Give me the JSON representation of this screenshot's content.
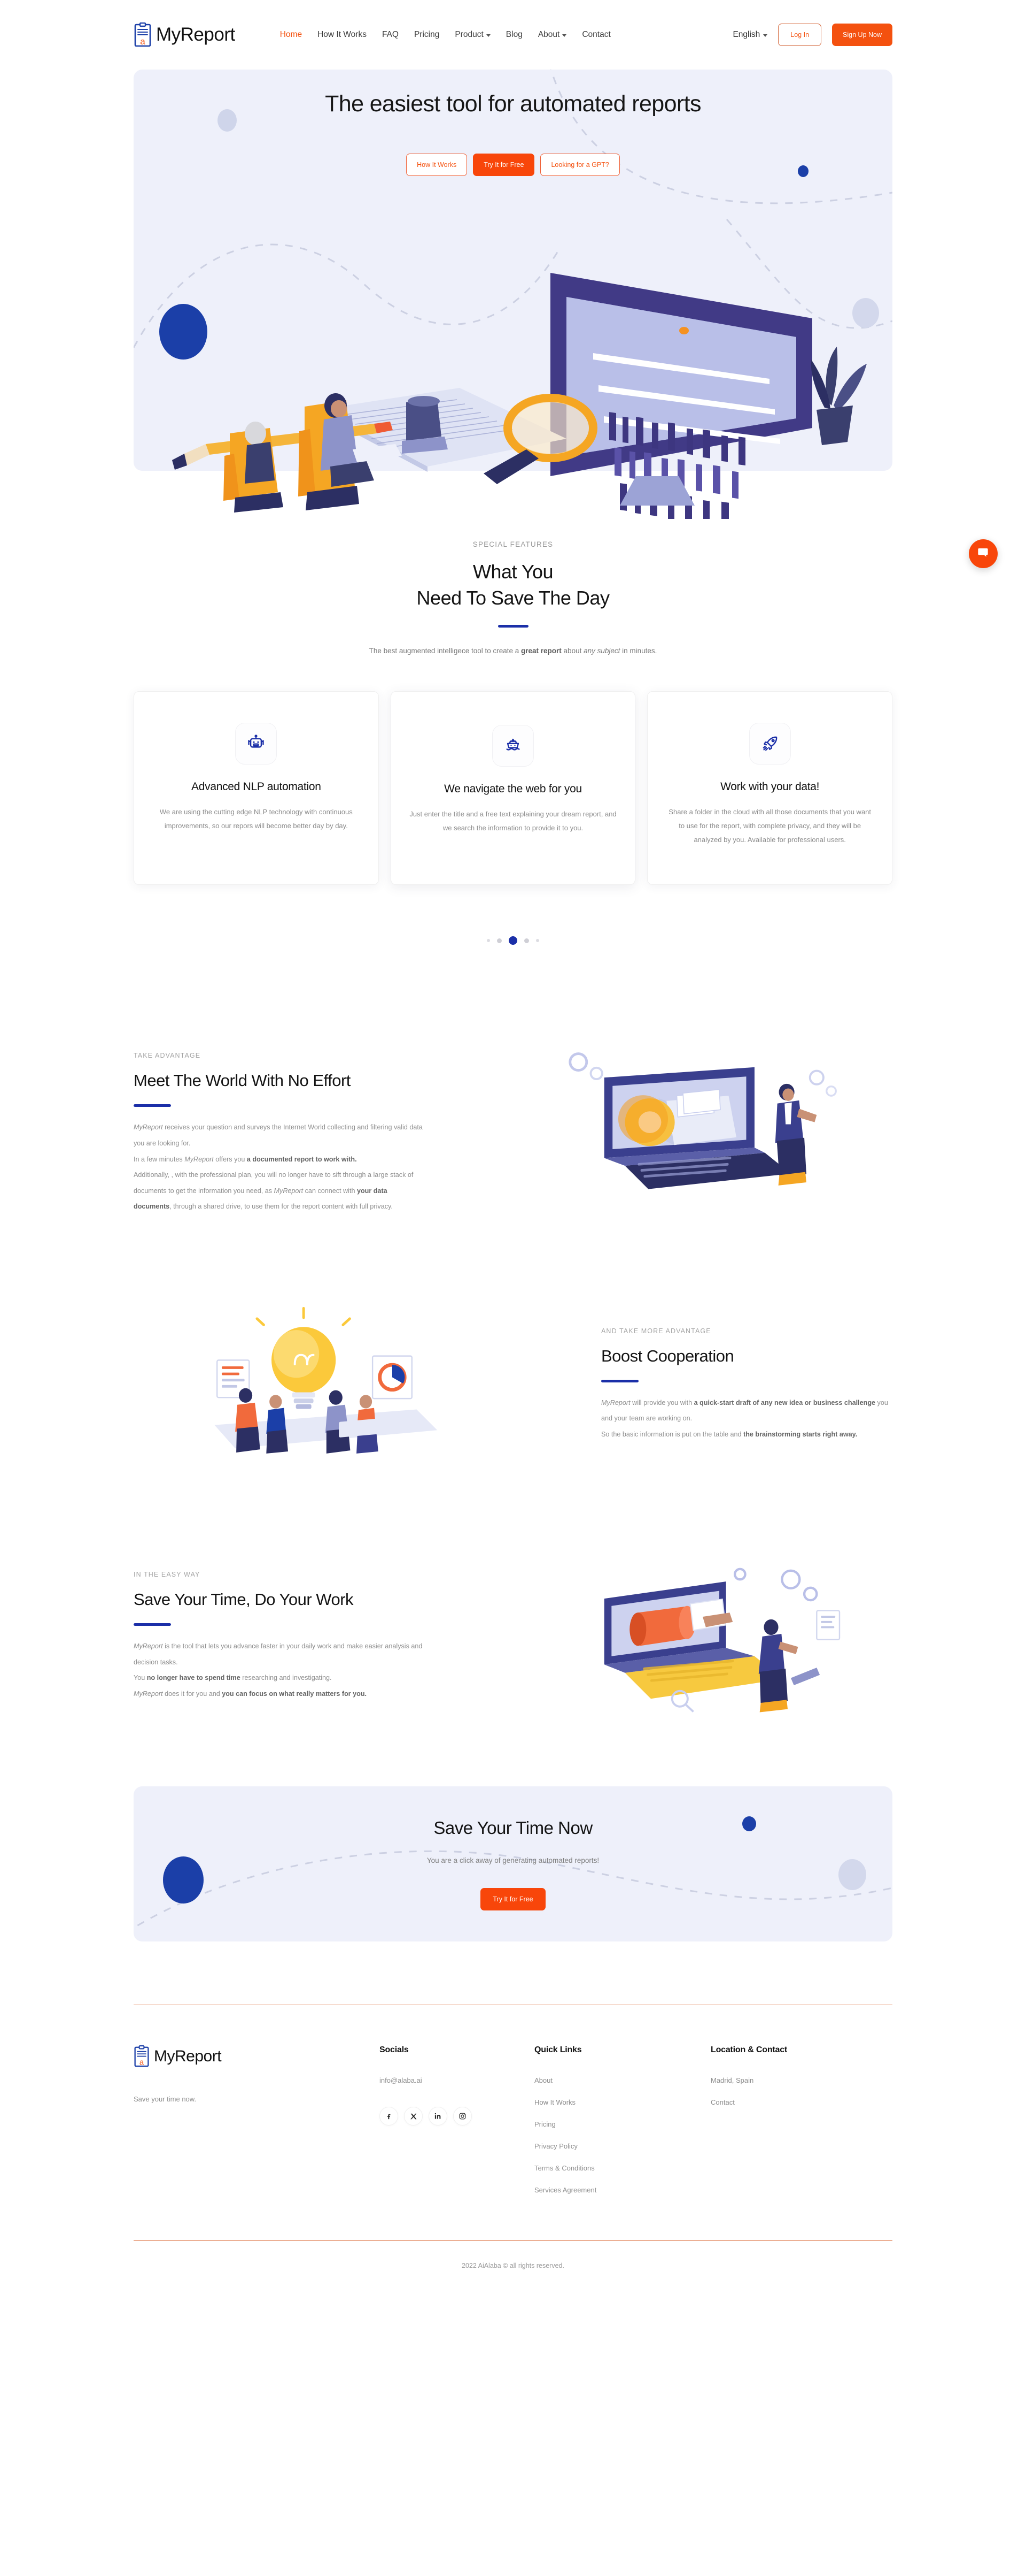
{
  "brand": {
    "name": "MyReport",
    "logo_icon": "clipboard-report-icon"
  },
  "nav": {
    "items": [
      {
        "label": "Home",
        "active": true,
        "caret": false
      },
      {
        "label": "How It Works",
        "active": false,
        "caret": false
      },
      {
        "label": "FAQ",
        "active": false,
        "caret": false
      },
      {
        "label": "Pricing",
        "active": false,
        "caret": false
      },
      {
        "label": "Product",
        "active": false,
        "caret": true
      },
      {
        "label": "Blog",
        "active": false,
        "caret": false
      },
      {
        "label": "About",
        "active": false,
        "caret": true
      },
      {
        "label": "Contact",
        "active": false,
        "caret": false
      }
    ],
    "language": "English",
    "login_label": "Log In",
    "signup_label": "Sign Up Now"
  },
  "hero": {
    "title": "The easiest tool for automated reports",
    "buttons": [
      {
        "label": "How It Works",
        "style": "outline"
      },
      {
        "label": "Try It for Free",
        "style": "primary"
      },
      {
        "label": "Looking for a GPT?",
        "style": "outline"
      }
    ]
  },
  "features": {
    "eyebrow": "SPECIAL FEATURES",
    "title_line1": "What You",
    "title_line2": "Need To Save The Day",
    "subtitle_pre": "The best augmented intelligece tool to create a ",
    "subtitle_bold": "great report",
    "subtitle_mid": " about ",
    "subtitle_italic": "any subject",
    "subtitle_post": " in minutes.",
    "cards": [
      {
        "icon": "robot-icon",
        "title": "Advanced NLP automation",
        "body": "We are using the cutting edge NLP technology with continuous improvements, so our repors will become better day by day."
      },
      {
        "icon": "ship-icon",
        "title": "We navigate the web for you",
        "body": "Just enter the title and a free text explaining your dream report, and we search the information to provide it to you."
      },
      {
        "icon": "rocket-icon",
        "title": "Work with your data!",
        "body": "Share a folder in the cloud with all those documents that you want to use for the report, with complete privacy, and they will be analyzed by you. Available for professional users."
      }
    ],
    "carousel": {
      "count": 5,
      "active_index": 2
    }
  },
  "sections": [
    {
      "eyebrow": "TAKE ADVANTAGE",
      "title": "Meet The World With No Effort",
      "paragraphs": [
        [
          {
            "t": "MyReport",
            "s": "i"
          },
          {
            "t": " receives your question and surveys the Internet World collecting and filtering valid data you are looking for.",
            "s": "n"
          }
        ],
        [
          {
            "t": "In a few minutes ",
            "s": "n"
          },
          {
            "t": "MyReport",
            "s": "i"
          },
          {
            "t": " offers you ",
            "s": "n"
          },
          {
            "t": "a documented report to work with.",
            "s": "b"
          }
        ],
        [
          {
            "t": "Additionally, , with the professional plan, you will no longer have to sift through a large stack of documents to get the information you need, as ",
            "s": "n"
          },
          {
            "t": "MyReport",
            "s": "i"
          },
          {
            "t": " can connect with ",
            "s": "n"
          },
          {
            "t": "your data documents",
            "s": "b"
          },
          {
            "t": ", through a shared drive, to use them for the report content with full privacy.",
            "s": "n"
          }
        ]
      ],
      "art": "document-search-illustration",
      "art_side": "right"
    },
    {
      "eyebrow": "AND TAKE MORE ADVANTAGE",
      "title": "Boost Cooperation",
      "paragraphs": [
        [
          {
            "t": "MyReport",
            "s": "i"
          },
          {
            "t": " will provide you with ",
            "s": "n"
          },
          {
            "t": "a quick-start draft of any new idea or business challenge",
            "s": "b"
          },
          {
            "t": " you and your team are working on.",
            "s": "n"
          }
        ],
        [
          {
            "t": "So the basic information is put on the table and ",
            "s": "n"
          },
          {
            "t": "the brainstorming starts right away.",
            "s": "b"
          }
        ]
      ],
      "art": "team-ideas-illustration",
      "art_side": "left"
    },
    {
      "eyebrow": "IN THE EASY WAY",
      "title": "Save Your Time, Do Your Work",
      "paragraphs": [
        [
          {
            "t": "MyReport",
            "s": "i"
          },
          {
            "t": " is the tool that lets you advance faster in your daily work and make easier analysis and decision tasks.",
            "s": "n"
          }
        ],
        [
          {
            "t": "You ",
            "s": "n"
          },
          {
            "t": "no longer have to spend time",
            "s": "b"
          },
          {
            "t": " researching and investigating.",
            "s": "n"
          }
        ],
        [
          {
            "t": "MyReport",
            "s": "i"
          },
          {
            "t": " does it for you and ",
            "s": "n"
          },
          {
            "t": "you can focus on what really matters for you.",
            "s": "b"
          }
        ]
      ],
      "art": "workflow-laptop-illustration",
      "art_side": "right"
    }
  ],
  "cta": {
    "title": "Save Your Time Now",
    "subtitle": "You are a click away of generating automated reports!",
    "button_label": "Try It for Free"
  },
  "footer": {
    "tagline": "Save your time now.",
    "socials": {
      "heading": "Socials",
      "email": "info@alaba.ai",
      "icons": [
        "facebook-icon",
        "x-twitter-icon",
        "linkedin-icon",
        "instagram-icon"
      ]
    },
    "quick_links": {
      "heading": "Quick Links",
      "items": [
        "About",
        "How It Works",
        "Pricing",
        "Privacy Policy",
        "Terms & Conditions",
        "Services Agreement"
      ]
    },
    "location": {
      "heading": "Location & Contact",
      "items": [
        "Madrid, Spain",
        "Contact"
      ]
    },
    "copyright": "2022 AiAlaba © all rights reserved."
  },
  "chat_widget": {
    "icon": "chat-bubble-icon"
  },
  "colors": {
    "accent_orange": "#f4510f",
    "accent_orange_solid": "#f8460a",
    "accent_blue": "#1b2fa8",
    "hero_bg": "#eef0fa",
    "muted_text": "#8d8d8d"
  }
}
